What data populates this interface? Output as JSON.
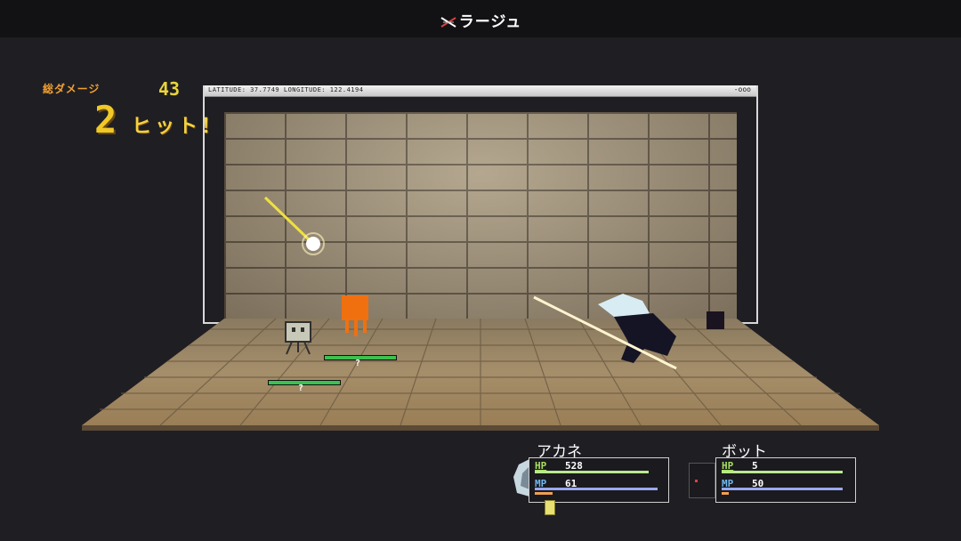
{
  "skill": {
    "name": "ラージュ",
    "icon": "sword-slash-icon"
  },
  "combo": {
    "total_label": "総ダメージ",
    "total_damage": "43",
    "hits": "2",
    "hits_label": "ヒット！"
  },
  "window": {
    "coords": "LATITUDE: 37.7749   LONGITUDE: 122.4194",
    "dots": "-ooo"
  },
  "enemies": [
    {
      "name": "robot-enemy",
      "hp_mark": "?",
      "hp": 1.0
    },
    {
      "name": "orange-enemy",
      "hp_mark": "?",
      "hp": 1.0
    }
  ],
  "party": [
    {
      "name": "アカネ",
      "hp_label": "HP",
      "hp": "528",
      "mp_label": "MP",
      "mp": "61",
      "hp_fill": 0.95,
      "mp_fill": 0.9,
      "portrait": "akane-portrait-icon"
    },
    {
      "name": "ボット",
      "hp_label": "HP",
      "hp": "5",
      "mp_label": "MP",
      "mp": "50",
      "hp_fill": 0.95,
      "mp_fill": 0.92,
      "portrait": "bot-portrait-icon"
    }
  ],
  "colors": {
    "hp_label": "#a8e060",
    "mp_label": "#70b8f0",
    "hp_bar": "#b8e890",
    "mp_bar": "#9aa8f0",
    "enemy_hp": "#3cc050"
  }
}
